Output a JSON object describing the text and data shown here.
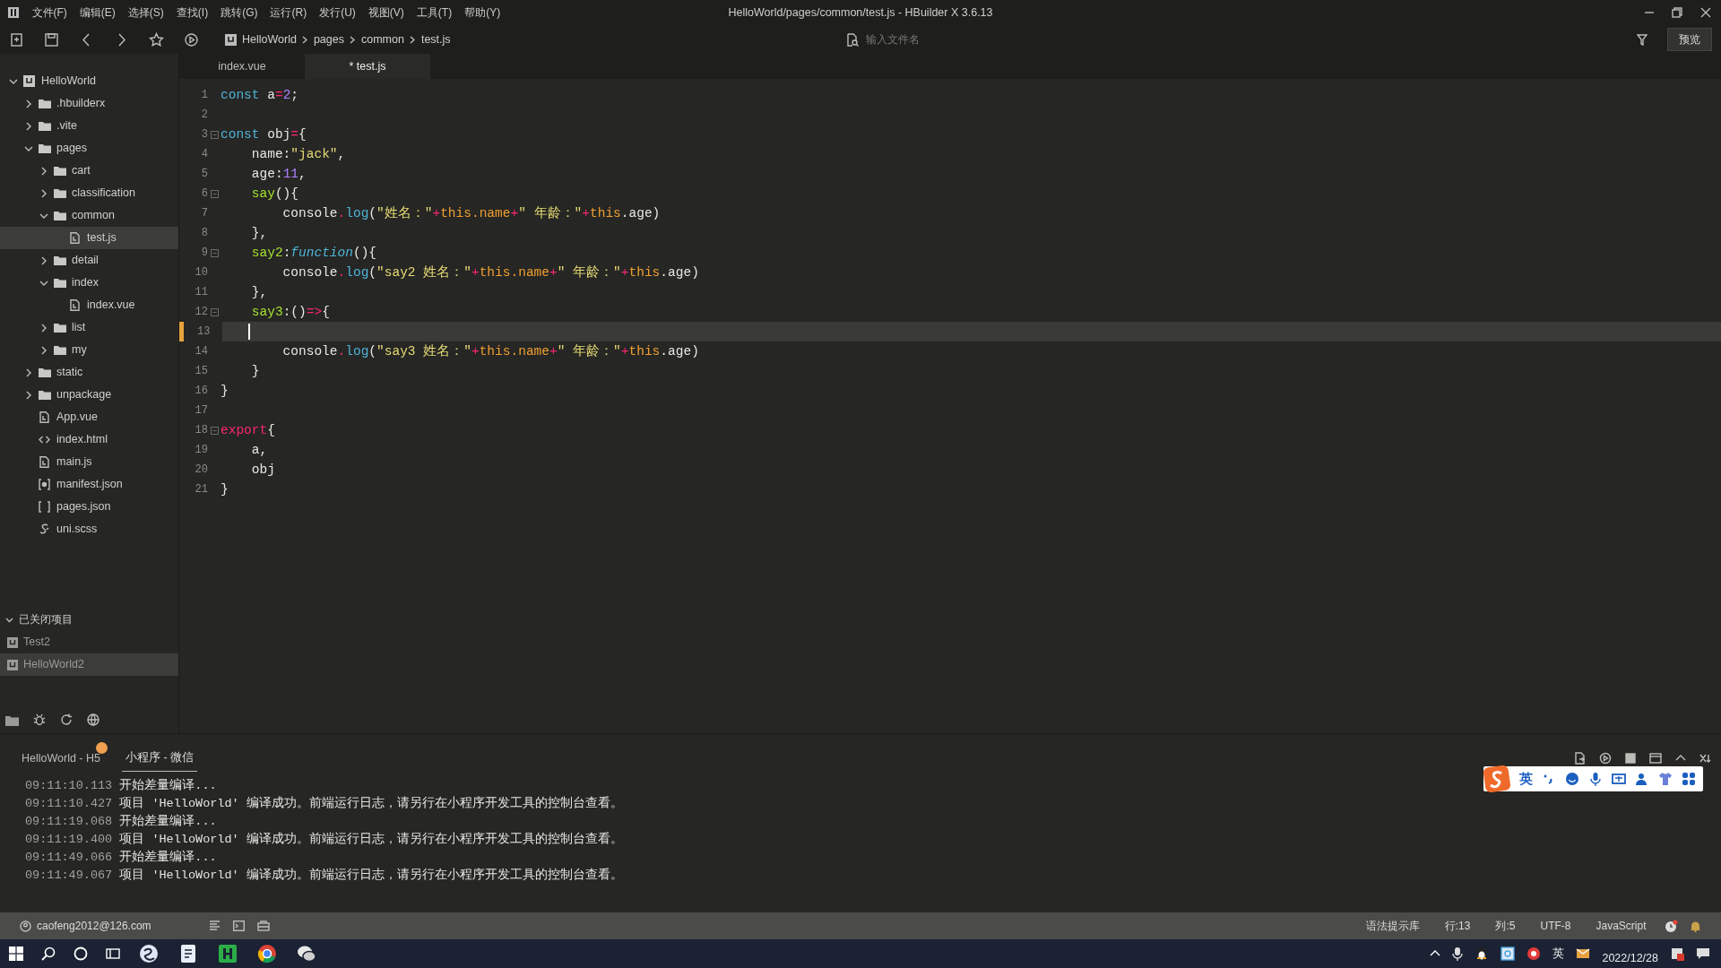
{
  "window": {
    "title": "HelloWorld/pages/common/test.js - HBuilder X 3.6.13"
  },
  "menu": [
    "文件(F)",
    "编辑(E)",
    "选择(S)",
    "查找(I)",
    "跳转(G)",
    "运行(R)",
    "发行(U)",
    "视图(V)",
    "工具(T)",
    "帮助(Y)"
  ],
  "toolbar": {
    "breadcrumb": [
      "HelloWorld",
      "pages",
      "common",
      "test.js"
    ],
    "search": {
      "placeholder": "输入文件名"
    },
    "preview_button": "预览"
  },
  "sidebar": {
    "tree": [
      {
        "label": "HelloWorld",
        "kind": "project",
        "expanded": true,
        "selected": false,
        "children": [
          {
            "label": ".hbuilderx",
            "kind": "folder",
            "expanded": false,
            "selected": false
          },
          {
            "label": ".vite",
            "kind": "folder",
            "expanded": false,
            "selected": false
          },
          {
            "label": "pages",
            "kind": "folder",
            "expanded": true,
            "selected": false,
            "children": [
              {
                "label": "cart",
                "kind": "folder",
                "expanded": false,
                "selected": false
              },
              {
                "label": "classification",
                "kind": "folder",
                "expanded": false,
                "selected": false
              },
              {
                "label": "common",
                "kind": "folder",
                "expanded": true,
                "selected": false,
                "children": [
                  {
                    "label": "test.js",
                    "kind": "file",
                    "selected": true
                  }
                ]
              },
              {
                "label": "detail",
                "kind": "folder",
                "expanded": false,
                "selected": false
              },
              {
                "label": "index",
                "kind": "folder",
                "expanded": true,
                "selected": false,
                "children": [
                  {
                    "label": "index.vue",
                    "kind": "file",
                    "selected": false
                  }
                ]
              },
              {
                "label": "list",
                "kind": "folder",
                "expanded": false,
                "selected": false
              },
              {
                "label": "my",
                "kind": "folder",
                "expanded": false,
                "selected": false
              }
            ]
          },
          {
            "label": "static",
            "kind": "folder",
            "expanded": false,
            "selected": false
          },
          {
            "label": "unpackage",
            "kind": "folder",
            "expanded": false,
            "selected": false
          },
          {
            "label": "App.vue",
            "kind": "file",
            "selected": false
          },
          {
            "label": "index.html",
            "kind": "html",
            "selected": false
          },
          {
            "label": "main.js",
            "kind": "file",
            "selected": false
          },
          {
            "label": "manifest.json",
            "kind": "manifest",
            "selected": false
          },
          {
            "label": "pages.json",
            "kind": "json",
            "selected": false
          },
          {
            "label": "uni.scss",
            "kind": "style",
            "selected": false
          }
        ]
      }
    ],
    "closed_projects": {
      "title": "已关闭项目",
      "expanded": true,
      "items": [
        {
          "label": "Test2",
          "selected": false
        },
        {
          "label": "HelloWorld2",
          "selected": true
        }
      ]
    }
  },
  "editor": {
    "tabs": [
      {
        "label": "index.vue",
        "selected": false
      },
      {
        "label": "* test.js",
        "selected": true
      }
    ],
    "lines": [
      {
        "number": "1",
        "fold": false,
        "current": false,
        "tokens": [
          {
            "kind": "kw",
            "text": "const"
          },
          {
            "kind": "plain",
            "text": " a"
          },
          {
            "kind": "op",
            "text": "="
          },
          {
            "kind": "num",
            "text": "2"
          },
          {
            "kind": "plain",
            "text": ";"
          }
        ]
      },
      {
        "number": "2",
        "fold": false,
        "current": false
      },
      {
        "number": "3",
        "fold": true,
        "current": false,
        "tokens": [
          {
            "kind": "kw",
            "text": "const"
          },
          {
            "kind": "plain",
            "text": " obj"
          },
          {
            "kind": "op",
            "text": "="
          },
          {
            "kind": "plain",
            "text": "{"
          }
        ]
      },
      {
        "number": "4",
        "fold": false,
        "current": false,
        "tokens": [
          {
            "kind": "plain",
            "text": "    name:"
          },
          {
            "kind": "str",
            "text": "\"jack\""
          },
          {
            "kind": "plain",
            "text": ","
          }
        ]
      },
      {
        "number": "5",
        "fold": false,
        "current": false,
        "tokens": [
          {
            "kind": "plain",
            "text": "    age:"
          },
          {
            "kind": "num",
            "text": "11"
          },
          {
            "kind": "plain",
            "text": ","
          }
        ]
      },
      {
        "number": "6",
        "fold": true,
        "current": false,
        "tokens": [
          {
            "kind": "prop",
            "text": "    say"
          },
          {
            "kind": "plain",
            "text": "(){"
          }
        ]
      },
      {
        "number": "7",
        "fold": false,
        "current": false,
        "tokens": [
          {
            "kind": "plain",
            "text": "        console"
          },
          {
            "kind": "op",
            "text": "."
          },
          {
            "kind": "fn",
            "text": "log"
          },
          {
            "kind": "plain",
            "text": "("
          },
          {
            "kind": "str",
            "text": "\"姓名："
          },
          {
            "kind": "str",
            "text": "\""
          },
          {
            "kind": "op",
            "text": "+"
          },
          {
            "kind": "this",
            "text": "this.name"
          },
          {
            "kind": "op",
            "text": "+"
          },
          {
            "kind": "str",
            "text": "\" 年龄：\""
          },
          {
            "kind": "op",
            "text": "+"
          },
          {
            "kind": "this",
            "text": "this"
          },
          {
            "kind": "plain",
            "text": ".age)"
          }
        ]
      },
      {
        "number": "8",
        "fold": false,
        "current": false,
        "tokens": [
          {
            "kind": "plain",
            "text": "    },"
          }
        ]
      },
      {
        "number": "9",
        "fold": true,
        "current": false,
        "tokens": [
          {
            "kind": "prop",
            "text": "    say2"
          },
          {
            "kind": "plain",
            "text": ":"
          },
          {
            "kind": "fnkw",
            "text": "function"
          },
          {
            "kind": "plain",
            "text": "(){"
          }
        ]
      },
      {
        "number": "10",
        "fold": false,
        "current": false,
        "tokens": [
          {
            "kind": "plain",
            "text": "        console"
          },
          {
            "kind": "op",
            "text": "."
          },
          {
            "kind": "fn",
            "text": "log"
          },
          {
            "kind": "plain",
            "text": "("
          },
          {
            "kind": "str",
            "text": "\"say2 姓名：\""
          },
          {
            "kind": "op",
            "text": "+"
          },
          {
            "kind": "this",
            "text": "this.name"
          },
          {
            "kind": "op",
            "text": "+"
          },
          {
            "kind": "str",
            "text": "\" 年龄：\""
          },
          {
            "kind": "op",
            "text": "+"
          },
          {
            "kind": "this",
            "text": "this"
          },
          {
            "kind": "plain",
            "text": ".age)"
          }
        ]
      },
      {
        "number": "11",
        "fold": false,
        "current": false,
        "tokens": [
          {
            "kind": "plain",
            "text": "    },"
          }
        ]
      },
      {
        "number": "12",
        "fold": true,
        "current": false,
        "tokens": [
          {
            "kind": "prop",
            "text": "    say3"
          },
          {
            "kind": "plain",
            "text": ":()"
          },
          {
            "kind": "op",
            "text": "=>"
          },
          {
            "kind": "plain",
            "text": "{"
          }
        ]
      },
      {
        "number": "13",
        "fold": false,
        "current": true
      },
      {
        "number": "14",
        "fold": false,
        "current": false,
        "tokens": [
          {
            "kind": "plain",
            "text": "        console"
          },
          {
            "kind": "op",
            "text": "."
          },
          {
            "kind": "fn",
            "text": "log"
          },
          {
            "kind": "plain",
            "text": "("
          },
          {
            "kind": "str",
            "text": "\"say3 姓名：\""
          },
          {
            "kind": "op",
            "text": "+"
          },
          {
            "kind": "this",
            "text": "this.name"
          },
          {
            "kind": "op",
            "text": "+"
          },
          {
            "kind": "str",
            "text": "\" 年龄：\""
          },
          {
            "kind": "op",
            "text": "+"
          },
          {
            "kind": "this",
            "text": "this"
          },
          {
            "kind": "plain",
            "text": ".age)"
          }
        ]
      },
      {
        "number": "15",
        "fold": false,
        "current": false,
        "tokens": [
          {
            "kind": "plain",
            "text": "    }"
          }
        ]
      },
      {
        "number": "16",
        "fold": false,
        "current": false,
        "tokens": [
          {
            "kind": "plain",
            "text": "}"
          }
        ]
      },
      {
        "number": "17",
        "fold": false,
        "current": false
      },
      {
        "number": "18",
        "fold": true,
        "current": false,
        "tokens": [
          {
            "kind": "export",
            "text": "export"
          },
          {
            "kind": "plain",
            "text": "{"
          }
        ]
      },
      {
        "number": "19",
        "fold": false,
        "current": false,
        "tokens": [
          {
            "kind": "plain",
            "text": "    a,"
          }
        ]
      },
      {
        "number": "20",
        "fold": false,
        "current": false,
        "tokens": [
          {
            "kind": "plain",
            "text": "    obj"
          }
        ]
      },
      {
        "number": "21",
        "fold": false,
        "current": false,
        "tokens": [
          {
            "kind": "plain",
            "text": "}"
          }
        ]
      }
    ]
  },
  "console": {
    "tabs": [
      {
        "label": "HelloWorld - H5",
        "selected": false,
        "badge": true
      },
      {
        "label": "小程序 - 微信",
        "selected": true,
        "badge": false
      }
    ],
    "logs": [
      {
        "time": "09:11:10.113",
        "message": "开始差量编译..."
      },
      {
        "time": "09:11:10.427",
        "message": "项目 'HelloWorld' 编译成功。前端运行日志，请另行在小程序开发工具的控制台查看。"
      },
      {
        "time": "09:11:19.068",
        "message": "开始差量编译..."
      },
      {
        "time": "09:11:19.400",
        "message": "项目 'HelloWorld' 编译成功。前端运行日志，请另行在小程序开发工具的控制台查看。"
      },
      {
        "time": "09:11:49.066",
        "message": "开始差量编译..."
      },
      {
        "time": "09:11:49.067",
        "message": "项目 'HelloWorld' 编译成功。前端运行日志，请另行在小程序开发工具的控制台查看。"
      }
    ]
  },
  "ime_bar": {
    "mode": "英"
  },
  "status_bar": {
    "account": "caofeng2012@126.com",
    "items": [
      "语法提示库",
      "行:13",
      "列:5",
      "UTF-8",
      "JavaScript"
    ]
  },
  "taskbar": {
    "ime": "英",
    "date": "2022/12/28"
  }
}
